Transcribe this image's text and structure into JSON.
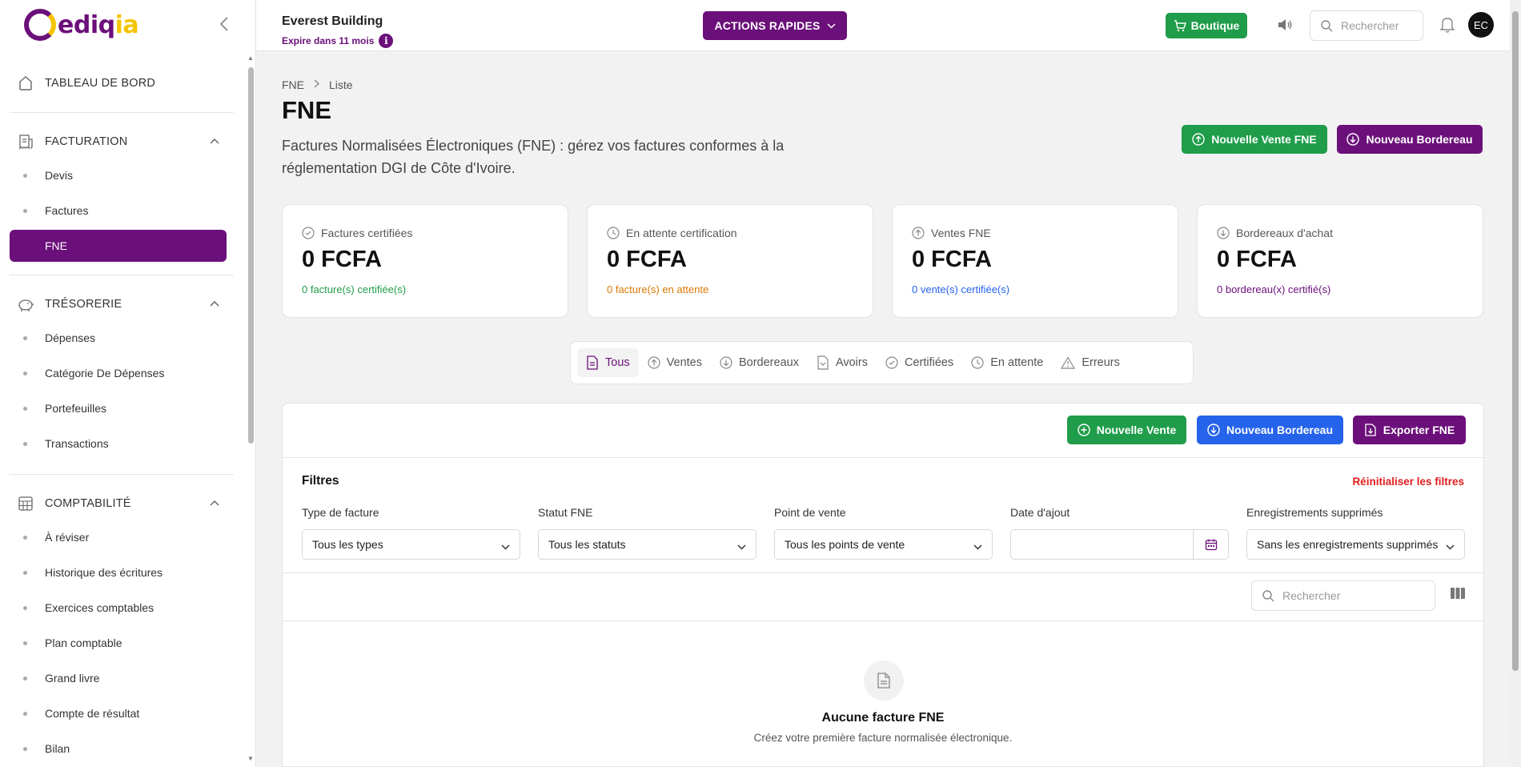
{
  "app": {
    "logo_text_main": "ediq",
    "logo_text_accent": "ia"
  },
  "sidebar": {
    "dashboard": "TABLEAU DE BORD",
    "facturation": {
      "label": "FACTURATION",
      "items": [
        "Devis",
        "Factures",
        "FNE"
      ]
    },
    "tresorerie": {
      "label": "TRÉSORERIE",
      "items": [
        "Dépenses",
        "Catégorie De Dépenses",
        "Portefeuilles",
        "Transactions"
      ]
    },
    "comptabilite": {
      "label": "COMPTABILITÉ",
      "items": [
        "À réviser",
        "Historique des écritures",
        "Exercices comptables",
        "Plan comptable",
        "Grand livre",
        "Compte de résultat",
        "Bilan"
      ]
    }
  },
  "header": {
    "org_name": "Everest Building",
    "org_expiry": "Expire dans 11 mois",
    "actions_label": "ACTIONS RAPIDES",
    "boutique_label": "Boutique",
    "search_placeholder": "Rechercher",
    "avatar_initials": "EC"
  },
  "page": {
    "breadcrumb": [
      "FNE",
      "Liste"
    ],
    "title": "FNE",
    "description": "Factures Normalisées Électroniques (FNE) : gérez vos factures conformes à la réglementation DGI de Côte d'Ivoire.",
    "btn_new_sale_fne": "Nouvelle Vente FNE",
    "btn_new_bordereau": "Nouveau Bordereau"
  },
  "stats": [
    {
      "label": "Factures certifiées",
      "value": "0 FCFA",
      "sub": "0 facture(s) certifiée(s)",
      "color": "#1f9d4a"
    },
    {
      "label": "En attente certification",
      "value": "0 FCFA",
      "sub": "0 facture(s) en attente",
      "color": "#d97706"
    },
    {
      "label": "Ventes FNE",
      "value": "0 FCFA",
      "sub": "0 vente(s) certifiée(s)",
      "color": "#2563eb"
    },
    {
      "label": "Bordereaux d'achat",
      "value": "0 FCFA",
      "sub": "0 bordereau(x) certifié(s)",
      "color": "#6b0f7a"
    }
  ],
  "tabs": [
    "Tous",
    "Ventes",
    "Bordereaux",
    "Avoirs",
    "Certifiées",
    "En attente",
    "Erreurs"
  ],
  "panel": {
    "btn_new_sale": "Nouvelle Vente",
    "btn_new_bordereau": "Nouveau Bordereau",
    "btn_export": "Exporter FNE",
    "filters_title": "Filtres",
    "reset_filters": "Réinitialiser les filtres",
    "filters": [
      {
        "label": "Type de facture",
        "value": "Tous les types"
      },
      {
        "label": "Statut FNE",
        "value": "Tous les statuts"
      },
      {
        "label": "Point de vente",
        "value": "Tous les points de vente"
      },
      {
        "label": "Date d'ajout",
        "value": ""
      },
      {
        "label": "Enregistrements supprimés",
        "value": "Sans les enregistrements supprimés"
      }
    ],
    "search_placeholder": "Rechercher",
    "empty_title": "Aucune facture FNE",
    "empty_sub": "Créez votre première facture normalisée électronique."
  },
  "colors": {
    "brand": "#6b0f7a",
    "brand_accent": "#f5c400",
    "success": "#1f9d4a",
    "info": "#2563eb",
    "danger": "#e11d1d"
  }
}
